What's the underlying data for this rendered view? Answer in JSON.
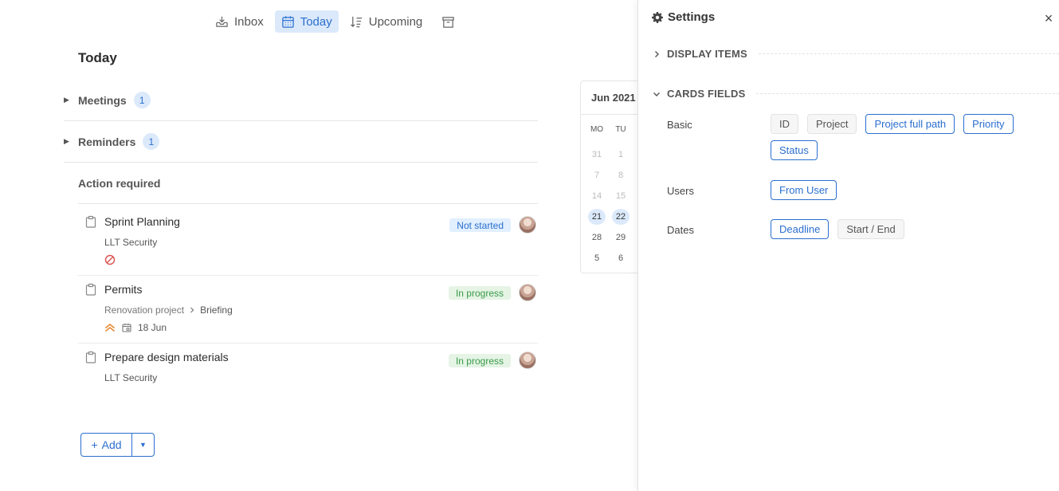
{
  "nav": {
    "inbox": "Inbox",
    "today": "Today",
    "upcoming": "Upcoming"
  },
  "page_title": "Today",
  "sections": {
    "meetings": {
      "label": "Meetings",
      "count": "1"
    },
    "reminders": {
      "label": "Reminders",
      "count": "1"
    },
    "action": {
      "label": "Action required"
    }
  },
  "tasks": [
    {
      "title": "Sprint Planning",
      "project": "LLT Security",
      "status": "Not started"
    },
    {
      "title": "Permits",
      "project": "Renovation project",
      "subproject": "Briefing",
      "status": "In progress",
      "date": "18 Jun"
    },
    {
      "title": "Prepare design materials",
      "project": "LLT Security",
      "status": "In progress"
    }
  ],
  "add_button": {
    "label": "Add",
    "plus": "+",
    "dropdown": "▼"
  },
  "calendar": {
    "month": "Jun 2021",
    "dow": [
      "MO",
      "TU"
    ],
    "rows": [
      [
        "31",
        "1"
      ],
      [
        "7",
        "8"
      ],
      [
        "14",
        "15"
      ],
      [
        "21",
        "22"
      ],
      [
        "28",
        "29"
      ],
      [
        "5",
        "6"
      ]
    ]
  },
  "settings": {
    "title": "Settings",
    "close": "×",
    "display_items": "DISPLAY ITEMS",
    "cards_fields": "CARDS FIELDS",
    "groups": {
      "basic": {
        "label": "Basic",
        "chips": [
          "ID",
          "Project",
          "Project full path",
          "Priority",
          "Status"
        ]
      },
      "users": {
        "label": "Users",
        "chips": [
          "From User"
        ]
      },
      "dates": {
        "label": "Dates",
        "chips": [
          "Deadline",
          "Start / End"
        ]
      }
    }
  },
  "colors": {
    "accent": "#2b6fcf",
    "accent_bg": "#dbe9fb",
    "green": "#3a9a4a",
    "danger": "#d9534f",
    "priority": "#e8892f"
  }
}
